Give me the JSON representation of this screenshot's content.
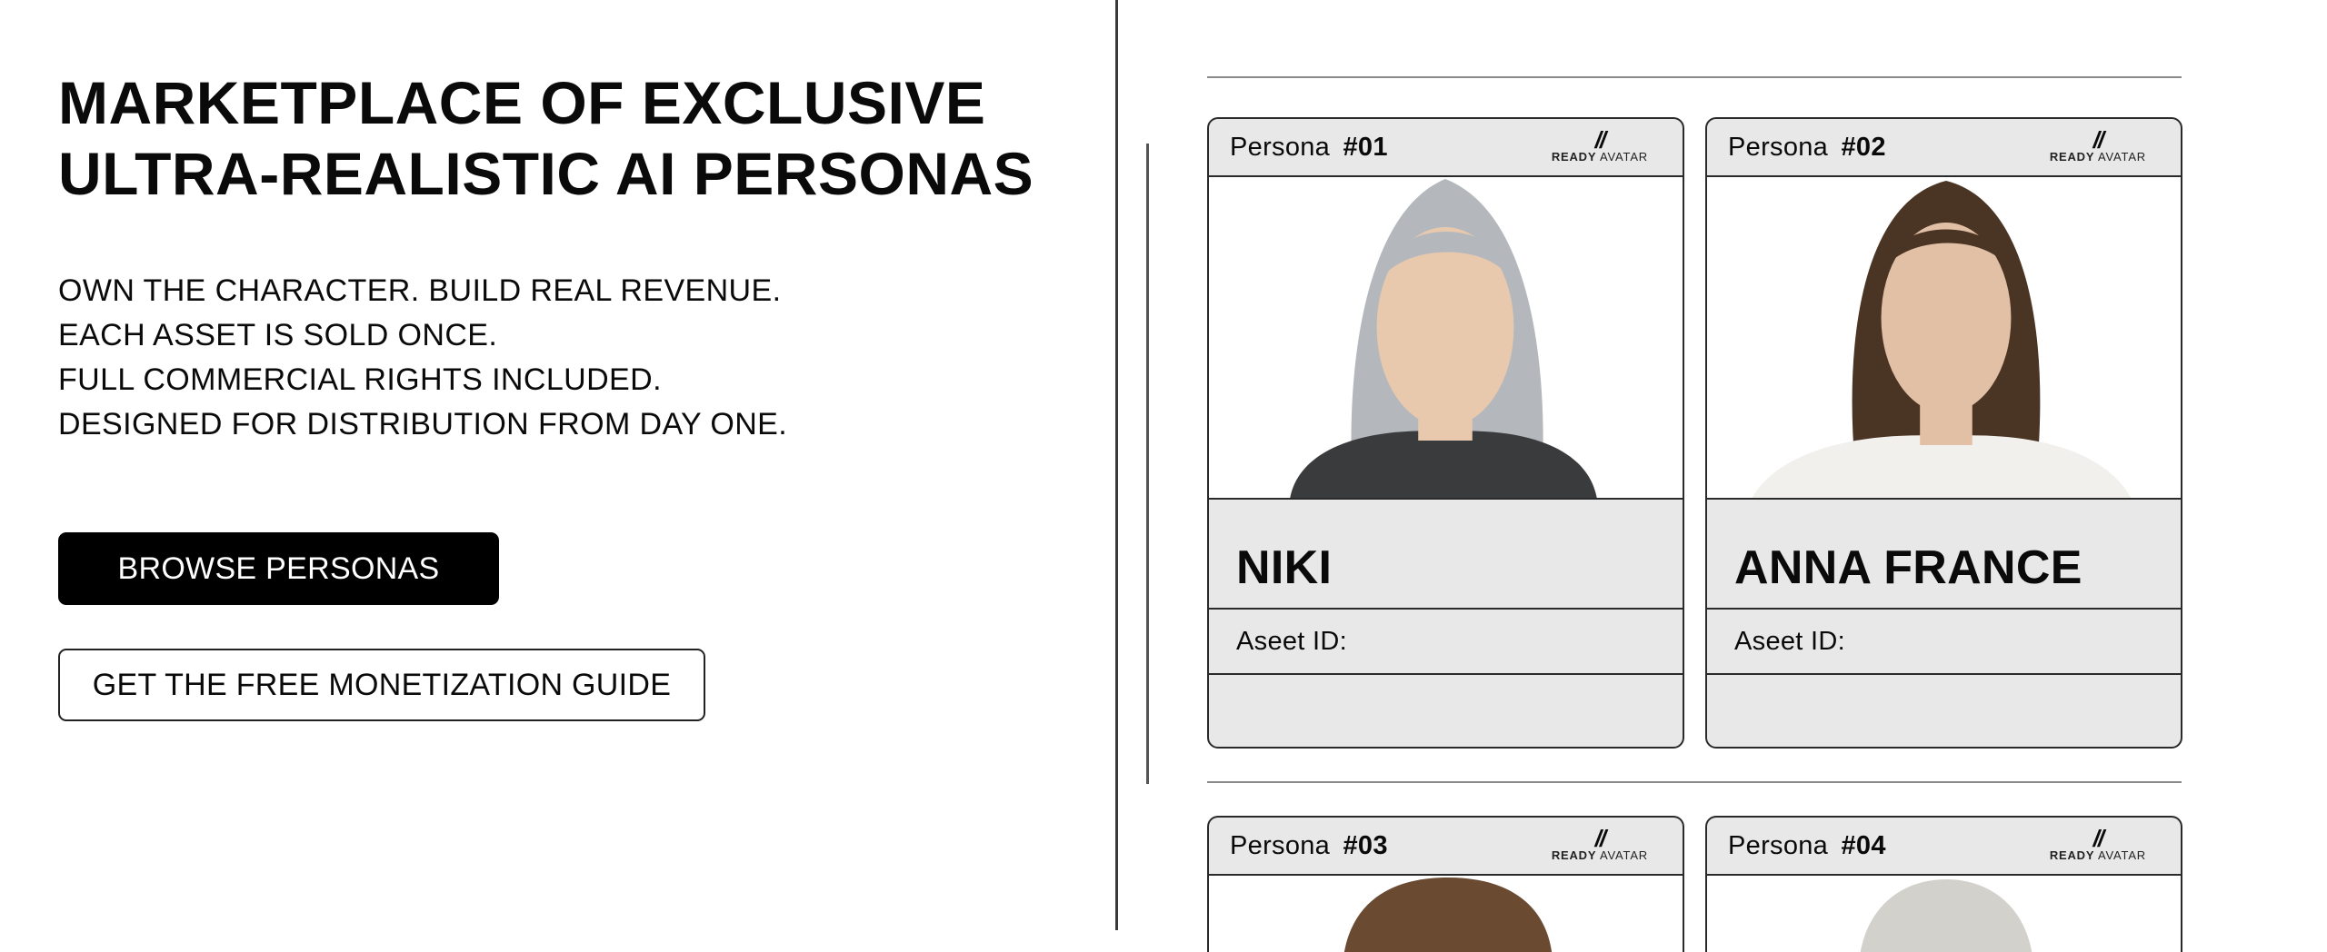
{
  "hero": {
    "headline_line1": "MARKETPLACE OF EXCLUSIVE",
    "headline_line2": "ULTRA-REALISTIC AI PERSONAS",
    "subtext": [
      "OWN THE CHARACTER. BUILD REAL REVENUE.",
      "EACH ASSET IS SOLD ONCE.",
      "FULL COMMERCIAL RIGHTS INCLUDED.",
      "DESIGNED FOR DISTRIBUTION FROM DAY ONE."
    ],
    "primary_button": "BROWSE PERSONAS",
    "secondary_button": "GET THE FREE MONETIZATION GUIDE"
  },
  "card_labels": {
    "persona_prefix": "Persona",
    "brand_mark": "//",
    "brand_ready": "READY",
    "brand_avatar": "AVATAR",
    "asset_label": "Aseet ID:"
  },
  "personas": [
    {
      "number": "#01",
      "name": "NIKI",
      "hair_color": "#b4b8bc",
      "skin_color": "#e8c9ae",
      "clothing_color": "#3a3b3d"
    },
    {
      "number": "#02",
      "name": "ANNA FRANCE",
      "hair_color": "#4a3424",
      "skin_color": "#e2c0a6",
      "clothing_color": "#f2f0ec"
    },
    {
      "number": "#03",
      "name": "",
      "hair_color": "#6b4a32"
    },
    {
      "number": "#04",
      "name": "",
      "hair_color": "#d3d1cc"
    }
  ],
  "colors": {
    "primary_button_bg": "#000000",
    "card_bg": "#e8e8e8",
    "divider": "#3a3a3a"
  }
}
